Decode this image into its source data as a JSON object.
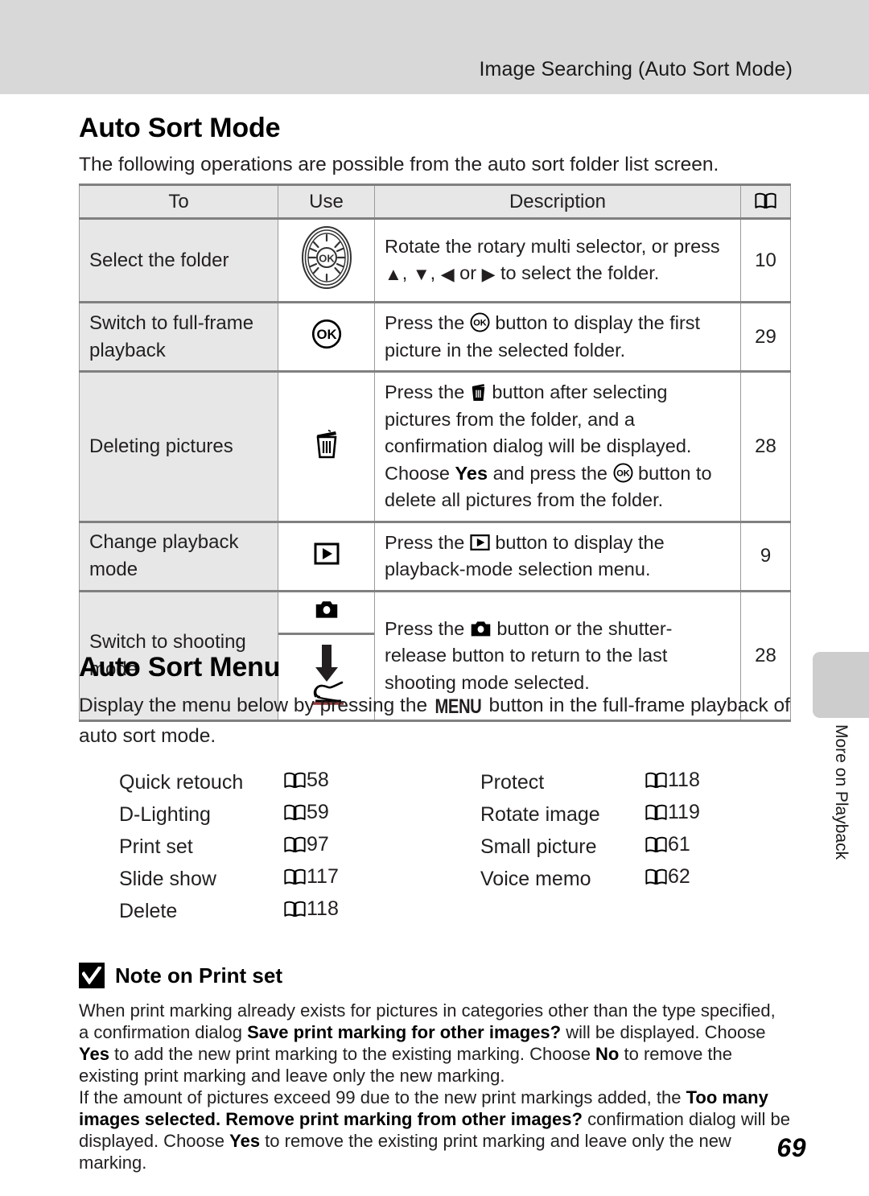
{
  "header": {
    "running_head": "Image Searching (Auto Sort Mode)"
  },
  "section1": {
    "title": "Auto Sort Mode",
    "intro": "The following operations are possible from the auto sort folder list screen."
  },
  "table": {
    "columns": [
      "To",
      "Use",
      "Description",
      "book-icon"
    ],
    "rows": [
      {
        "to": "Select the folder",
        "use_icon": "rotary-multi-selector-icon",
        "description_pre": "Rotate the rotary multi selector, or press ",
        "description_mid": ", ",
        "description_mid2": ",",
        "description_or": " or ",
        "description_post": " to select the folder.",
        "page": "10"
      },
      {
        "to": "Switch to full-frame playback",
        "use_icon": "ok-button-icon",
        "description_pre": "Press the ",
        "description_post": " button to display the first picture in the selected folder.",
        "page": "29"
      },
      {
        "to": "Deleting pictures",
        "use_icon": "trash-icon",
        "description_pre": "Press the ",
        "description_p2": " button after selecting pictures from the folder, and a confirmation dialog will be displayed. Choose ",
        "description_yes": "Yes",
        "description_p3": " and press the ",
        "description_p4": " button to delete all pictures from the folder.",
        "page": "28"
      },
      {
        "to": "Change playback mode",
        "use_icon": "playback-button-icon",
        "description_pre": "Press the ",
        "description_post": " button to display the playback-mode selection menu.",
        "page": "9"
      },
      {
        "to": "Switch to shooting mode",
        "use_icon": "camera-button-icon",
        "use_icon2": "shutter-release-press-icon",
        "description_pre": "Press the ",
        "description_post": " button or the shutter-release button to return to the last shooting mode selected.",
        "page": "28"
      }
    ]
  },
  "section2": {
    "title": "Auto Sort Menu",
    "intro_pre": "Display the menu below by pressing the ",
    "intro_menu": "MENU",
    "intro_post": " button in the full-frame playback of auto sort mode."
  },
  "menu": {
    "left": [
      {
        "label": "Quick retouch",
        "ref": "58"
      },
      {
        "label": "D-Lighting",
        "ref": "59"
      },
      {
        "label": "Print set",
        "ref": "97"
      },
      {
        "label": "Slide show",
        "ref": "117"
      },
      {
        "label": "Delete",
        "ref": "118"
      }
    ],
    "right": [
      {
        "label": "Protect",
        "ref": "118"
      },
      {
        "label": "Rotate image",
        "ref": "119"
      },
      {
        "label": "Small picture",
        "ref": "61"
      },
      {
        "label": "Voice memo",
        "ref": "62"
      }
    ]
  },
  "note": {
    "icon": "checkmark-box-icon",
    "title": "Note on Print set",
    "p1_a": "When print marking already exists for pictures in categories other than the type specified, a confirmation dialog ",
    "p1_b": "Save print marking for other images?",
    "p1_c": " will be displayed. Choose ",
    "p1_d": "Yes",
    "p1_e": " to add the new print marking to the existing marking. Choose ",
    "p1_f": "No",
    "p1_g": " to remove the existing print marking and leave only the new marking.",
    "p2_a": "If the amount of pictures exceed 99 due to the new print markings added, the ",
    "p2_b": "Too many images selected. Remove print marking from other images?",
    "p2_c": " confirmation dialog will be displayed. Choose ",
    "p2_d": "Yes",
    "p2_e": " to remove the existing print marking and leave only the new marking."
  },
  "side_tab": {
    "label": "More on Playback"
  },
  "folio": {
    "page_number": "69"
  }
}
